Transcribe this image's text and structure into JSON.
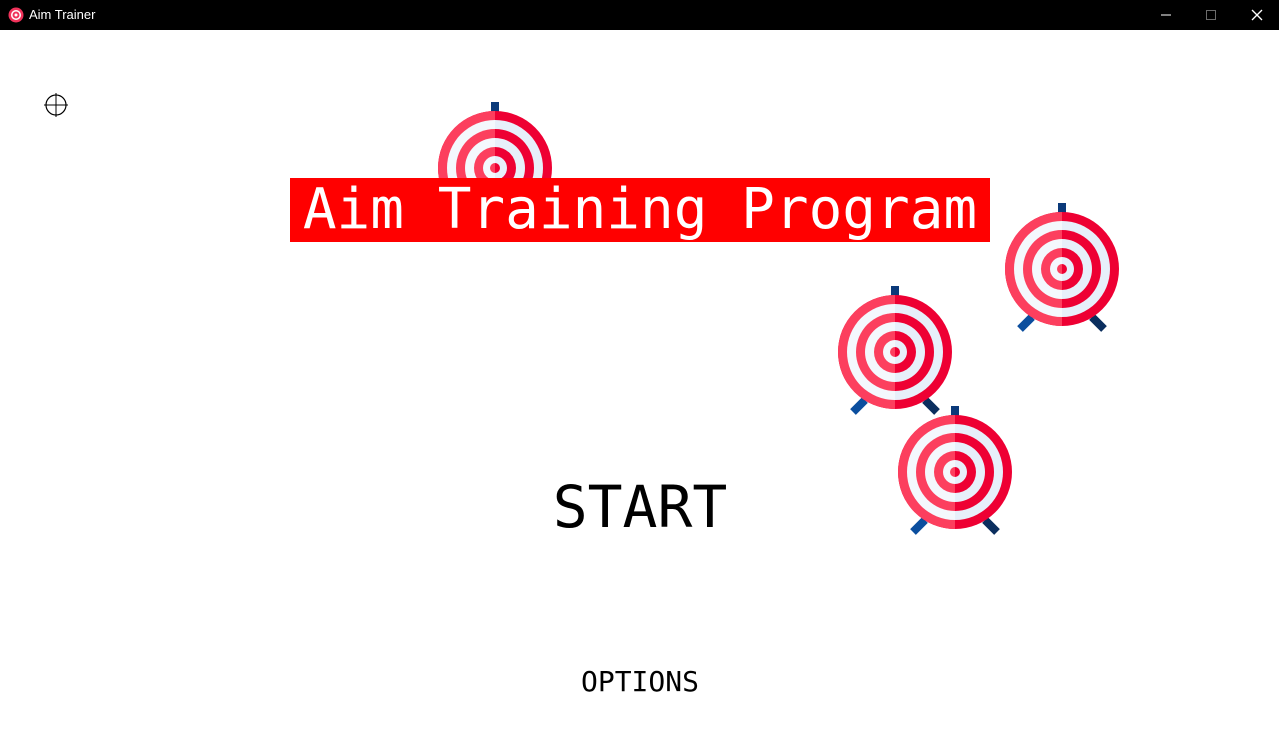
{
  "window": {
    "title": "Aim Trainer",
    "icon": "target-icon",
    "controls": [
      "minimize-icon",
      "maximize-icon",
      "close-icon"
    ]
  },
  "colors": {
    "titlebar_bg": "#000000",
    "banner_bg": "#ff0000",
    "banner_text": "#ffffff",
    "target_red": "#ee0033",
    "target_light_red": "#fc3f5e",
    "target_white": "#e7effa",
    "target_stand": "#0b3a7a"
  },
  "menu": {
    "title": "Aim Training Program",
    "start_label": "START",
    "options_label": "OPTIONS"
  },
  "cursor": {
    "icon": "crosshair-icon"
  },
  "decorations": {
    "target_icon": "archery-target-icon",
    "target_count": 4
  }
}
